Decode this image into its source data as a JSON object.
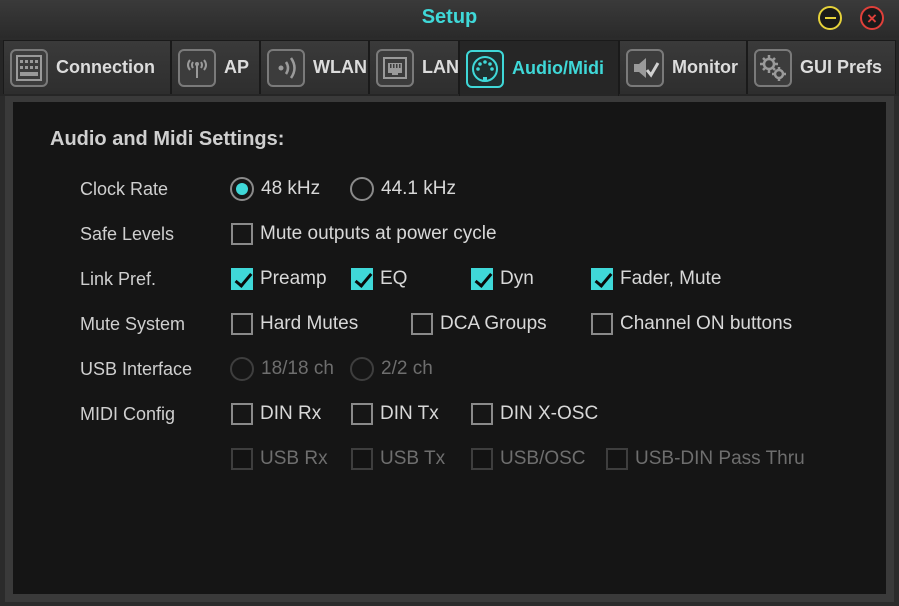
{
  "window": {
    "title": "Setup"
  },
  "tabs": [
    {
      "label": "Connection",
      "icon": "mixer-console-icon",
      "active": false
    },
    {
      "label": "AP",
      "icon": "antenna-icon",
      "active": false
    },
    {
      "label": "WLAN",
      "icon": "wifi-signal-icon",
      "active": false
    },
    {
      "label": "LAN",
      "icon": "ethernet-port-icon",
      "active": false
    },
    {
      "label": "Audio/Midi",
      "icon": "midi-connector-icon",
      "active": true
    },
    {
      "label": "Monitor",
      "icon": "speaker-check-icon",
      "active": false
    },
    {
      "label": "GUI Prefs",
      "icon": "gears-icon",
      "active": false
    }
  ],
  "section": {
    "heading": "Audio and Midi Settings:",
    "clock_rate": {
      "label": "Clock Rate",
      "options": [
        "48 kHz",
        "44.1 kHz"
      ],
      "selected": "48 kHz"
    },
    "safe_levels": {
      "label": "Safe Levels",
      "options": [
        {
          "text": "Mute outputs at power cycle",
          "checked": false
        }
      ]
    },
    "link_pref": {
      "label": "Link Pref.",
      "options": [
        {
          "text": "Preamp",
          "checked": true
        },
        {
          "text": "EQ",
          "checked": true
        },
        {
          "text": "Dyn",
          "checked": true
        },
        {
          "text": "Fader, Mute",
          "checked": true
        }
      ]
    },
    "mute_system": {
      "label": "Mute System",
      "options": [
        {
          "text": "Hard Mutes",
          "checked": false
        },
        {
          "text": "DCA Groups",
          "checked": false
        },
        {
          "text": "Channel ON buttons",
          "checked": false
        }
      ]
    },
    "usb_interface": {
      "label": "USB Interface",
      "options": [
        "18/18 ch",
        "2/2 ch"
      ],
      "selected": null,
      "enabled": false
    },
    "midi_config": {
      "label": "MIDI Config",
      "options": [
        {
          "text": "DIN Rx",
          "checked": false
        },
        {
          "text": "DIN Tx",
          "checked": false
        },
        {
          "text": "DIN X-OSC",
          "checked": false
        }
      ],
      "usb_options": [
        {
          "text": "USB Rx",
          "checked": false,
          "enabled": false
        },
        {
          "text": "USB Tx",
          "checked": false,
          "enabled": false
        },
        {
          "text": "USB/OSC",
          "checked": false,
          "enabled": false
        },
        {
          "text": "USB-DIN Pass Thru",
          "checked": false,
          "enabled": false
        }
      ]
    }
  },
  "colors": {
    "accent": "#3fd8d8",
    "minimize": "#e6d23a",
    "close": "#e0403a"
  }
}
